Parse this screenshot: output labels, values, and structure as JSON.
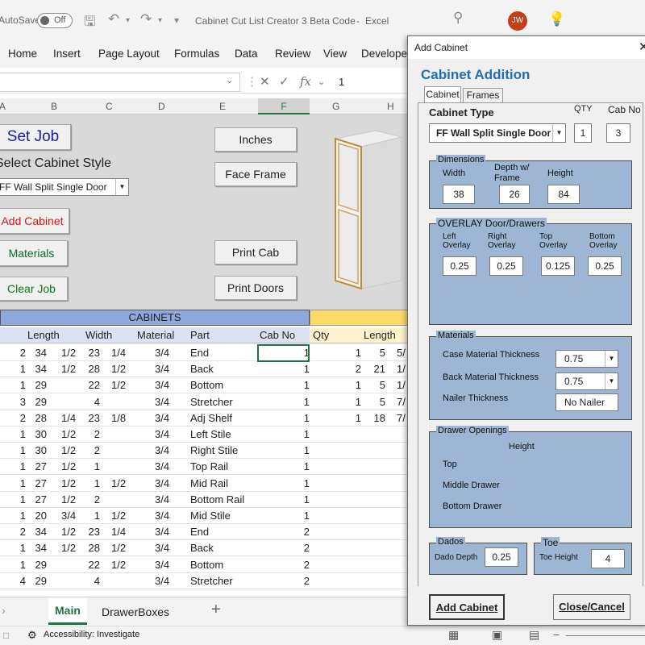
{
  "titlebar": {
    "autosave": "AutoSave",
    "autosave_state": "Off",
    "document_title": "Cabinet Cut List Creator 3 Beta Code",
    "app_name": "Excel",
    "user_initials": "JW"
  },
  "ribbon_tabs": [
    "Home",
    "Insert",
    "Page Layout",
    "Formulas",
    "Data",
    "Review",
    "View",
    "Develope"
  ],
  "formula_bar": {
    "value": "1"
  },
  "columns": [
    "A",
    "B",
    "C",
    "D",
    "E",
    "F",
    "G",
    "H"
  ],
  "sheet_buttons": {
    "set_job": "Set Job",
    "select_style_label": "Select Cabinet Style",
    "style_value": "FF Wall Split Single Door",
    "add_cabinet": "Add Cabinet",
    "materials": "Materials",
    "clear_job": "Clear Job",
    "inches": "Inches",
    "face_frame": "Face Frame",
    "print_cab": "Print Cab",
    "print_doors": "Print Doors"
  },
  "table": {
    "section_title": "CABINETS",
    "headers": [
      "Length",
      "Width",
      "Material",
      "Part",
      "Cab No"
    ],
    "right_headers": [
      "Qty",
      "Length"
    ],
    "rows": [
      [
        "2",
        "34",
        "1/2",
        "23",
        "1/4",
        "3/4",
        "End",
        "1",
        "1",
        "5",
        "5/"
      ],
      [
        "1",
        "34",
        "1/2",
        "28",
        "1/2",
        "3/4",
        "Back",
        "1",
        "2",
        "21",
        "1/"
      ],
      [
        "1",
        "29",
        "",
        "22",
        "1/2",
        "3/4",
        "Bottom",
        "1",
        "1",
        "5",
        "1/"
      ],
      [
        "3",
        "29",
        "",
        "4",
        "",
        "3/4",
        "Stretcher",
        "1",
        "1",
        "5",
        "7/"
      ],
      [
        "2",
        "28",
        "1/4",
        "23",
        "1/8",
        "3/4",
        "Adj Shelf",
        "1",
        "1",
        "18",
        "7/"
      ],
      [
        "1",
        "30",
        "1/2",
        "2",
        "",
        "3/4",
        "Left Stile",
        "1",
        "",
        "",
        ""
      ],
      [
        "1",
        "30",
        "1/2",
        "2",
        "",
        "3/4",
        "Right Stile",
        "1",
        "",
        "",
        ""
      ],
      [
        "1",
        "27",
        "1/2",
        "1",
        "",
        "3/4",
        "Top Rail",
        "1",
        "",
        "",
        ""
      ],
      [
        "1",
        "27",
        "1/2",
        "1",
        "1/2",
        "3/4",
        "Mid Rail",
        "1",
        "",
        "",
        ""
      ],
      [
        "1",
        "27",
        "1/2",
        "2",
        "",
        "3/4",
        "Bottom Rail",
        "1",
        "",
        "",
        ""
      ],
      [
        "1",
        "20",
        "3/4",
        "1",
        "1/2",
        "3/4",
        "Mid Stile",
        "1",
        "",
        "",
        ""
      ],
      [
        "2",
        "34",
        "1/2",
        "23",
        "1/4",
        "3/4",
        "End",
        "2",
        "",
        "",
        ""
      ],
      [
        "1",
        "34",
        "1/2",
        "28",
        "1/2",
        "3/4",
        "Back",
        "2",
        "",
        "",
        ""
      ],
      [
        "1",
        "29",
        "",
        "22",
        "1/2",
        "3/4",
        "Bottom",
        "2",
        "",
        "",
        ""
      ],
      [
        "4",
        "29",
        "",
        "4",
        "",
        "3/4",
        "Stretcher",
        "2",
        "",
        "",
        ""
      ]
    ]
  },
  "sheet_tabs": [
    "Main",
    "DrawerBoxes"
  ],
  "status": {
    "accessibility": "Accessibility: Investigate"
  },
  "dialog": {
    "window_title": "Add Cabinet",
    "heading": "Cabinet Addition",
    "tabs": [
      "Cabinet",
      "Frames"
    ],
    "cabinet_type_label": "Cabinet Type",
    "cabinet_type_value": "FF Wall Split Single Door",
    "qty_label": "QTY",
    "qty_value": "1",
    "cab_no_label": "Cab No",
    "cab_no_value": "3",
    "dimensions": {
      "legend": "Dimensions",
      "width_label": "Width",
      "depth_label_1": "Depth w/",
      "depth_label_2": "Frame",
      "height_label": "Height",
      "width": "38",
      "depth": "26",
      "height": "84"
    },
    "overlay": {
      "legend": "OVERLAY Door/Drawers",
      "left_1": "Left",
      "left_2": "Overlay",
      "right_1": "Right",
      "right_2": "Overlay",
      "top_1": "Top",
      "top_2": "Overlay",
      "bottom_1": "Bottom",
      "bottom_2": "Overlay",
      "left": "0.25",
      "right": "0.25",
      "top": "0.125",
      "bottom": "0.25"
    },
    "materials": {
      "legend": "Materials",
      "case_label": "Case Material Thickness",
      "case_value": "0.75",
      "back_label": "Back Material Thickness",
      "back_value": "0.75",
      "nailer_label": "Nailer Thickness",
      "nailer_value": "No Nailer"
    },
    "drawers": {
      "legend": "Drawer Openings",
      "height_label": "Height",
      "top": "Top",
      "middle": "Middle Drawer",
      "bottom": "Bottom Drawer"
    },
    "dados": {
      "legend": "Dados",
      "depth_label": "Dado Depth",
      "depth": "0.25"
    },
    "toe": {
      "legend": "Toe",
      "height_label": "Toe Height",
      "height": "4"
    },
    "add_button": "Add Cabinet",
    "close_button": "Close/Cancel"
  },
  "colors": {
    "accent_green": "#217346",
    "cabinets_header": "#8ea9db",
    "right_header": "#ffd966",
    "dialog_group": "#9cb6d3",
    "heading_blue": "#1f6fb8"
  }
}
